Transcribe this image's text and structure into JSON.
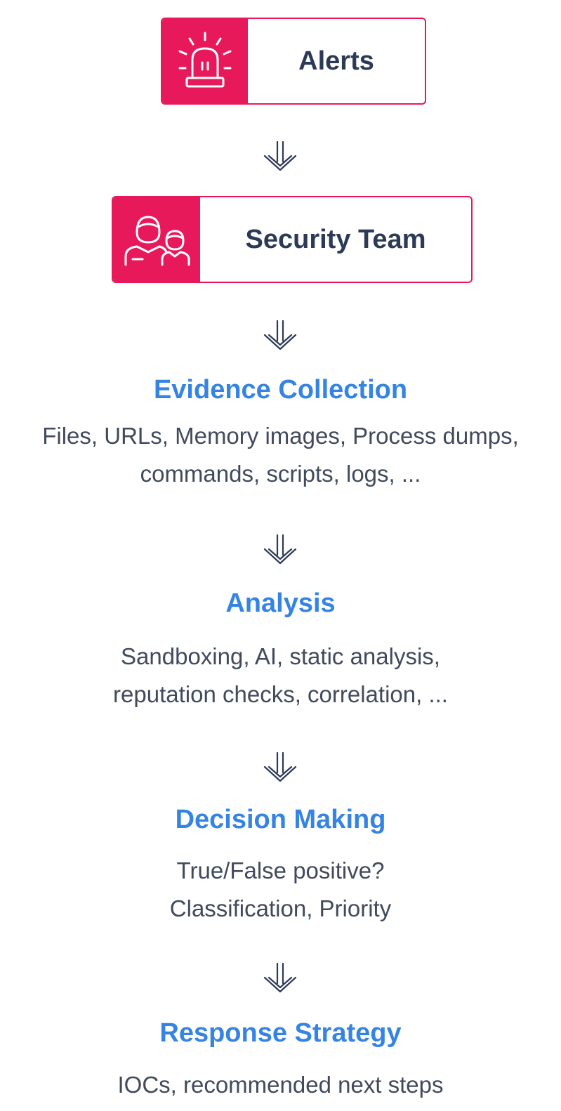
{
  "colors": {
    "accent": "#e8195a",
    "heading": "#3584e4",
    "body_text": "#414a5c",
    "box_text": "#2c3a57"
  },
  "boxes": [
    {
      "label": "Alerts",
      "icon": "alarm-siren-icon"
    },
    {
      "label": "Security Team",
      "icon": "team-people-icon"
    }
  ],
  "steps": [
    {
      "title": "Evidence Collection",
      "lines": [
        "Files, URLs, Memory images, Process dumps,",
        "commands, scripts, logs, ..."
      ]
    },
    {
      "title": "Analysis",
      "lines": [
        "Sandboxing, AI, static analysis,",
        "reputation checks, correlation, ..."
      ]
    },
    {
      "title": "Decision Making",
      "lines": [
        "True/False positive?",
        "Classification, Priority"
      ]
    },
    {
      "title": "Response Strategy",
      "lines": [
        "IOCs, recommended next steps"
      ]
    }
  ],
  "arrow_icon": "double-chevron-down-icon"
}
